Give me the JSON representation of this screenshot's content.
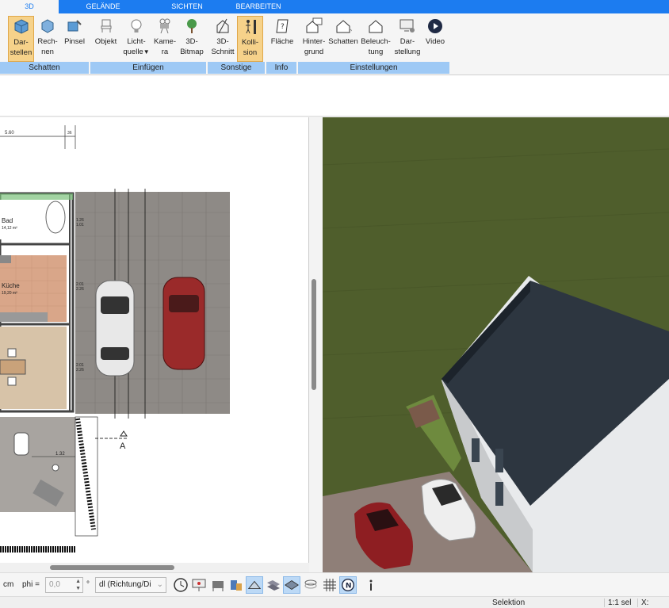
{
  "tabs": {
    "t3d": "3D",
    "gelaende": "GELÄNDE",
    "sichten": "SICHTEN",
    "bearbeiten": "BEARBEITEN"
  },
  "ribbon": {
    "darstellen": [
      "Dar-",
      "stellen"
    ],
    "rechnen": [
      "Rech-",
      "nen"
    ],
    "pinsel": [
      "Pinsel"
    ],
    "objekt": [
      "Objekt"
    ],
    "lichtquelle": [
      "Licht-",
      "quelle"
    ],
    "kamera": [
      "Kame-",
      "ra"
    ],
    "bitmap3d": [
      "3D-",
      "Bitmap"
    ],
    "schnitt3d": [
      "3D-",
      "Schnitt"
    ],
    "kollision": [
      "Kolli-",
      "sion"
    ],
    "flaeche": [
      "Fläche"
    ],
    "hintergrund": [
      "Hinter-",
      "grund"
    ],
    "schatten": [
      "Schatten"
    ],
    "beleuchtung": [
      "Beleuch-",
      "tung"
    ],
    "darstellung": [
      "Dar-",
      "stellung"
    ],
    "video": [
      "Video"
    ],
    "groups": {
      "schatten": "Schatten",
      "einfuegen": "Einfügen",
      "sonstige": "Sonstige",
      "info": "Info",
      "einstellungen": "Einstellungen"
    }
  },
  "plan": {
    "dim_top": "5.60",
    "dim_top_right": "36",
    "room_bad": "Bad",
    "room_bad_area": "14,12 m²",
    "room_kueche": "Küche",
    "room_kueche_area": "19,20 m²",
    "dim_r1": "1.26",
    "dim_r2": "1.01",
    "dim_r3": "2.01",
    "dim_r4": "2.26",
    "dim_r5": "2.01",
    "dim_r6": "2.26",
    "dim_bottom": "1.32",
    "section_marker": "A"
  },
  "toolbar": {
    "unit": "cm",
    "phi_label": "phi =",
    "phi_value": "0,0",
    "degree": "°",
    "direction_select": "dl (Richtung/Di"
  },
  "status": {
    "mode": "Selektion",
    "scale": "1:1 sel",
    "coord_x": "X:"
  },
  "colors": {
    "tab_blue": "#1c7cf0",
    "group_label": "#9ec9f5",
    "selected_button": "#f6d28a",
    "grass": "#4e5d2b",
    "roof": "#2d3640",
    "car_red": "#8e1e22"
  }
}
